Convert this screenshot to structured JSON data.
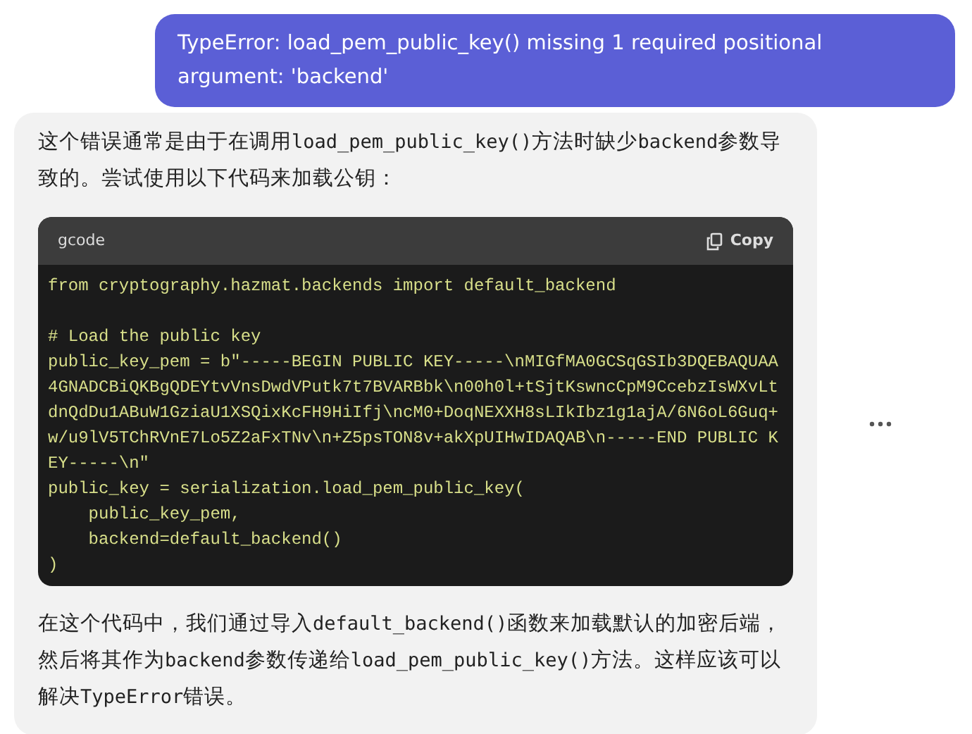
{
  "user_message": "TypeError: load_pem_public_key() missing 1 required positional argument: 'backend'",
  "answer": {
    "intro": [
      {
        "text": "这个错误通常是由于在调用",
        "code": false
      },
      {
        "text": "load_pem_public_key()",
        "code": true
      },
      {
        "text": "方法时缺少",
        "code": false
      },
      {
        "text": "backend",
        "code": true
      },
      {
        "text": "参数导致的。尝试使用以下代码来加载公钥：",
        "code": false
      }
    ],
    "code_block": {
      "language": "gcode",
      "copy_label": "Copy",
      "blocks": [
        [
          "from cryptography.hazmat.backends import default_backend"
        ],
        [
          "# Load the public key",
          "public_key_pem = b\"-----BEGIN PUBLIC KEY-----\\nMIGfMA0GCSqGSIb3DQEBAQUAA",
          "4GNADCBiQKBgQDEYtvVnsDwdVPutk7t7BVARBbk\\n00h0l+tSjtKswncCpM9CcebzIsWXvLt",
          "dnQdDu1ABuW1GziaU1XSQixKcFH9HiIfj\\ncM0+DoqNEXXH8sLIkIbz1g1ajA/6N6oL6Guq+",
          "w/u9lV5TChRVnE7Lo5Z2aFxTNv\\n+Z5psTON8v+akXpUIHwIDAQAB\\n-----END PUBLIC K",
          "EY-----\\n\"",
          "public_key = serialization.load_pem_public_key(",
          "    public_key_pem,",
          "    backend=default_backend()",
          ")"
        ]
      ]
    },
    "outro": [
      {
        "text": "在这个代码中，我们通过导入",
        "code": false
      },
      {
        "text": "default_backend()",
        "code": true
      },
      {
        "text": "函数来加载默认的加密后端，然后将其作为",
        "code": false
      },
      {
        "text": "backend",
        "code": true
      },
      {
        "text": "参数传递给",
        "code": false
      },
      {
        "text": "load_pem_public_key()",
        "code": true
      },
      {
        "text": "方法。这样应该可以解决",
        "code": false
      },
      {
        "text": "TypeError",
        "code": true
      },
      {
        "text": "错误。",
        "code": false
      }
    ]
  }
}
